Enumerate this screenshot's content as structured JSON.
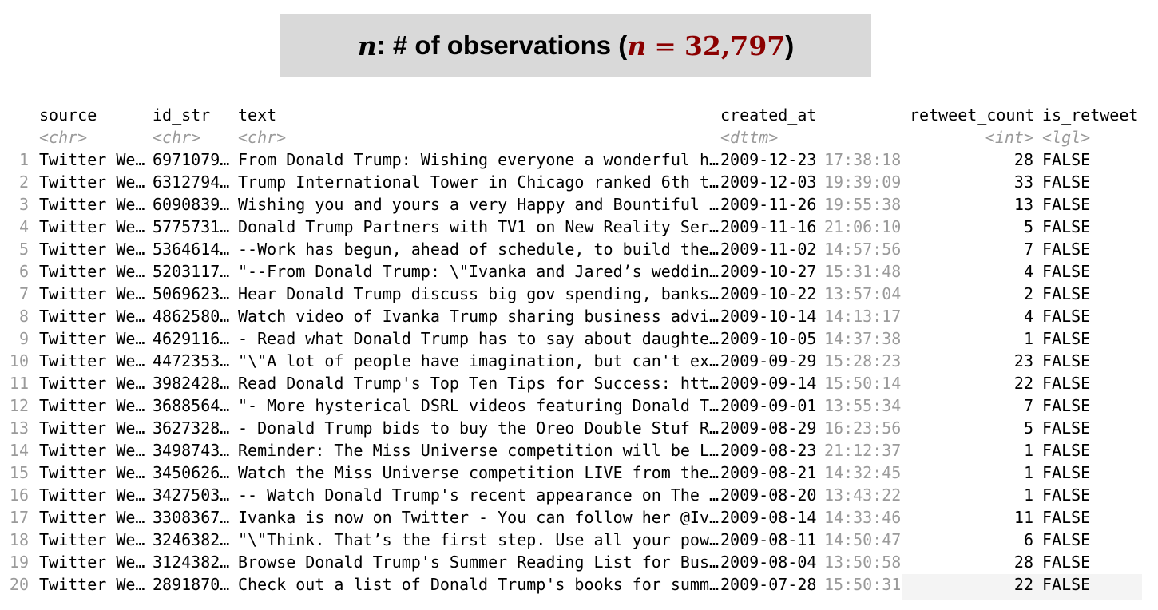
{
  "banner": {
    "n_symbol": "n",
    "label": ": # of observations (",
    "n_symbol2": "n",
    "equals": "=",
    "value": "32,797",
    "close": ")"
  },
  "table": {
    "headers": {
      "source": "source",
      "id_str": "id_str",
      "text": "text",
      "created_at": "created_at",
      "retweet_count": "retweet_count",
      "is_retweet": "is_retweet"
    },
    "types": {
      "source": "<chr>",
      "id_str": "<chr>",
      "text": "<chr>",
      "created_at": "<dttm>",
      "retweet_count": "<int>",
      "is_retweet": "<lgl>"
    },
    "rows": [
      {
        "n": "1",
        "source": "Twitter We…",
        "id": "6971079…",
        "text": "From Donald Trump: Wishing everyone a wonderful h…",
        "date": "2009-12-23",
        "time": "17:38:18",
        "rt": "28",
        "isrt": "FALSE"
      },
      {
        "n": "2",
        "source": "Twitter We…",
        "id": "6312794…",
        "text": "Trump International Tower in Chicago ranked 6th t…",
        "date": "2009-12-03",
        "time": "19:39:09",
        "rt": "33",
        "isrt": "FALSE"
      },
      {
        "n": "3",
        "source": "Twitter We…",
        "id": "6090839…",
        "text": "Wishing you and yours a very Happy and Bountiful …",
        "date": "2009-11-26",
        "time": "19:55:38",
        "rt": "13",
        "isrt": "FALSE"
      },
      {
        "n": "4",
        "source": "Twitter We…",
        "id": "5775731…",
        "text": "Donald Trump Partners with TV1 on New Reality Ser…",
        "date": "2009-11-16",
        "time": "21:06:10",
        "rt": "5",
        "isrt": "FALSE"
      },
      {
        "n": "5",
        "source": "Twitter We…",
        "id": "5364614…",
        "text": "--Work has begun, ahead of schedule, to build the…",
        "date": "2009-11-02",
        "time": "14:57:56",
        "rt": "7",
        "isrt": "FALSE"
      },
      {
        "n": "6",
        "source": "Twitter We…",
        "id": "5203117…",
        "text": "\"--From Donald Trump: \\\"Ivanka and Jared’s weddin…",
        "date": "2009-10-27",
        "time": "15:31:48",
        "rt": "4",
        "isrt": "FALSE"
      },
      {
        "n": "7",
        "source": "Twitter We…",
        "id": "5069623…",
        "text": "Hear Donald Trump discuss big gov spending, banks…",
        "date": "2009-10-22",
        "time": "13:57:04",
        "rt": "2",
        "isrt": "FALSE"
      },
      {
        "n": "8",
        "source": "Twitter We…",
        "id": "4862580…",
        "text": "Watch video of Ivanka Trump sharing business advi…",
        "date": "2009-10-14",
        "time": "14:13:17",
        "rt": "4",
        "isrt": "FALSE"
      },
      {
        "n": "9",
        "source": "Twitter We…",
        "id": "4629116…",
        "text": "- Read what Donald Trump has to say about daughte…",
        "date": "2009-10-05",
        "time": "14:37:38",
        "rt": "1",
        "isrt": "FALSE"
      },
      {
        "n": "10",
        "source": "Twitter We…",
        "id": "4472353…",
        "text": "\"\\\"A lot of people have imagination, but can't ex…",
        "date": "2009-09-29",
        "time": "15:28:23",
        "rt": "23",
        "isrt": "FALSE"
      },
      {
        "n": "11",
        "source": "Twitter We…",
        "id": "3982428…",
        "text": "Read Donald Trump's Top Ten Tips for Success: htt…",
        "date": "2009-09-14",
        "time": "15:50:14",
        "rt": "22",
        "isrt": "FALSE"
      },
      {
        "n": "12",
        "source": "Twitter We…",
        "id": "3688564…",
        "text": "\"- More hysterical DSRL videos featuring Donald T…",
        "date": "2009-09-01",
        "time": "13:55:34",
        "rt": "7",
        "isrt": "FALSE"
      },
      {
        "n": "13",
        "source": "Twitter We…",
        "id": "3627328…",
        "text": "- Donald Trump bids to buy the Oreo Double Stuf R…",
        "date": "2009-08-29",
        "time": "16:23:56",
        "rt": "5",
        "isrt": "FALSE"
      },
      {
        "n": "14",
        "source": "Twitter We…",
        "id": "3498743…",
        "text": "Reminder: The Miss Universe competition will be L…",
        "date": "2009-08-23",
        "time": "21:12:37",
        "rt": "1",
        "isrt": "FALSE"
      },
      {
        "n": "15",
        "source": "Twitter We…",
        "id": "3450626…",
        "text": "Watch the Miss Universe competition LIVE from the…",
        "date": "2009-08-21",
        "time": "14:32:45",
        "rt": "1",
        "isrt": "FALSE"
      },
      {
        "n": "16",
        "source": "Twitter We…",
        "id": "3427503…",
        "text": "-- Watch Donald Trump's recent appearance on The …",
        "date": "2009-08-20",
        "time": "13:43:22",
        "rt": "1",
        "isrt": "FALSE"
      },
      {
        "n": "17",
        "source": "Twitter We…",
        "id": "3308367…",
        "text": "Ivanka is now on Twitter - You can follow her @Iv…",
        "date": "2009-08-14",
        "time": "14:33:46",
        "rt": "11",
        "isrt": "FALSE"
      },
      {
        "n": "18",
        "source": "Twitter We…",
        "id": "3246382…",
        "text": "\"\\\"Think. That’s the first step. Use all your pow…",
        "date": "2009-08-11",
        "time": "14:50:47",
        "rt": "6",
        "isrt": "FALSE"
      },
      {
        "n": "19",
        "source": "Twitter We…",
        "id": "3124382…",
        "text": "Browse Donald Trump's Summer Reading List for Bus…",
        "date": "2009-08-04",
        "time": "13:50:58",
        "rt": "28",
        "isrt": "FALSE"
      },
      {
        "n": "20",
        "source": "Twitter We…",
        "id": "2891870…",
        "text": "Check out a list of Donald Trump's books for summ…",
        "date": "2009-07-28",
        "time": "15:50:31",
        "rt": "22",
        "isrt": "FALSE"
      }
    ]
  }
}
